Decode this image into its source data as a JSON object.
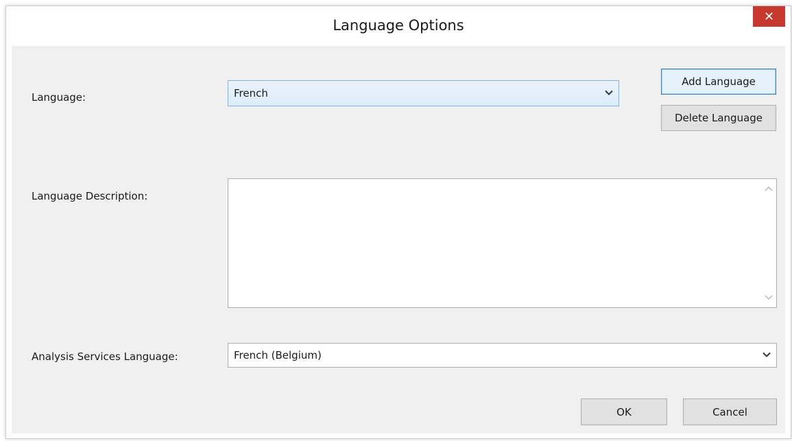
{
  "window": {
    "title": "Language Options",
    "close_icon_glyph": "✕"
  },
  "form": {
    "language_label": "Language:",
    "language_value": "French",
    "description_label": "Language Description:",
    "description_value": "",
    "as_language_label": "Analysis Services Language:",
    "as_language_value": "French (Belgium)"
  },
  "buttons": {
    "add_language": "Add Language",
    "delete_language": "Delete Language",
    "ok": "OK",
    "cancel": "Cancel"
  },
  "icons": {
    "dropdown": "chevron-down-icon",
    "scroll_up": "scroll-up-icon",
    "scroll_down": "scroll-down-icon",
    "close": "close-icon"
  },
  "colors": {
    "close_button": "#c7392f",
    "dialog_background": "#f0f0f0",
    "focus_border": "#7eb4ea"
  }
}
